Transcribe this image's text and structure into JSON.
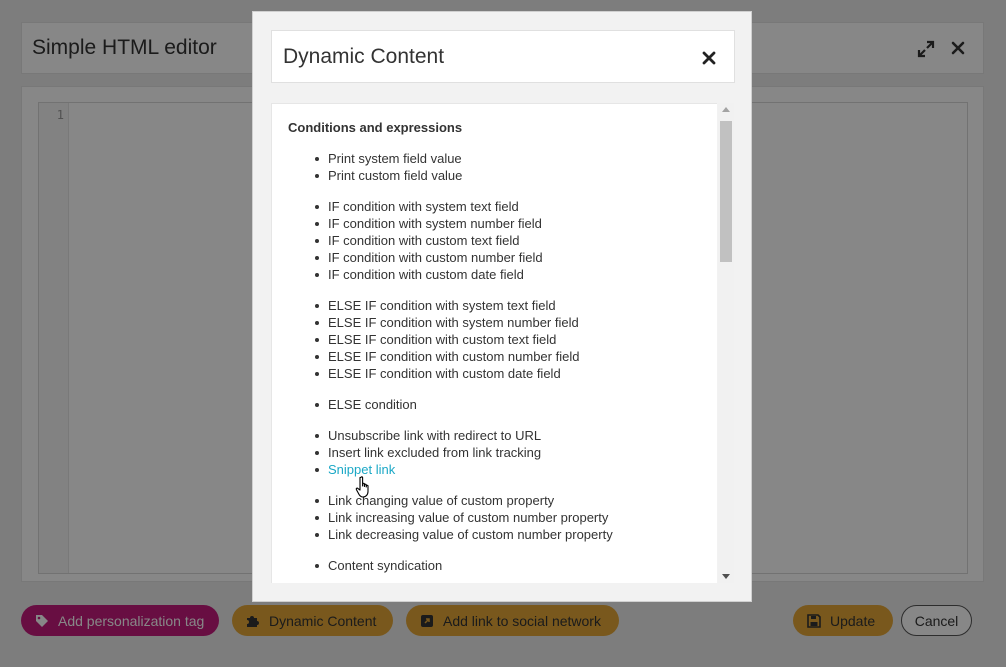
{
  "editor": {
    "title": "Simple HTML editor",
    "line_number": "1",
    "footer": {
      "add_tag_label": "Add personalization tag",
      "dynamic_content_label": "Dynamic Content",
      "add_social_label": "Add link to social network",
      "update_label": "Update",
      "cancel_label": "Cancel"
    }
  },
  "modal": {
    "title": "Dynamic Content",
    "section_heading": "Conditions and expressions",
    "groups": [
      {
        "items": [
          "Print system field value",
          "Print custom field value"
        ]
      },
      {
        "items": [
          "IF condition with system text field",
          "IF condition with system number field",
          "IF condition with custom text field",
          "IF condition with custom number field",
          "IF condition with custom date field"
        ]
      },
      {
        "items": [
          "ELSE IF condition with system text field",
          "ELSE IF condition with system number field",
          "ELSE IF condition with custom text field",
          "ELSE IF condition with custom number field",
          "ELSE IF condition with custom date field"
        ]
      },
      {
        "items": [
          "ELSE condition"
        ]
      },
      {
        "items": [
          "Unsubscribe link with redirect to URL",
          "Insert link excluded from link tracking",
          "Snippet link"
        ]
      },
      {
        "items": [
          "Link changing value of custom property",
          "Link increasing value of custom number property",
          "Link decreasing value of custom number property"
        ]
      },
      {
        "items": [
          "Content syndication"
        ]
      }
    ]
  },
  "colors": {
    "tag_button": "#c41b7e",
    "accent_button": "#e4a737",
    "link": "#1ba8c6"
  },
  "icons": {
    "editor_expand": "expand-icon",
    "editor_close": "close-icon",
    "modal_close": "close-icon",
    "tag": "tag-icon",
    "dynamic_content": "puzzle-icon",
    "social": "link-box-icon",
    "update": "save-icon",
    "cursor": "hand-pointer-icon"
  }
}
